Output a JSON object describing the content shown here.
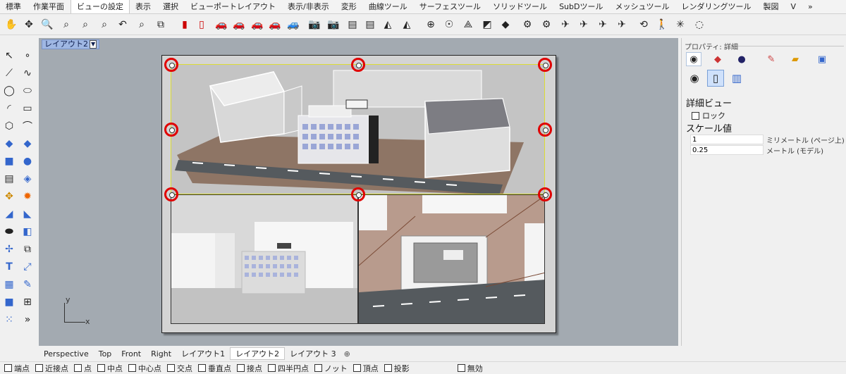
{
  "tabs": [
    "標準",
    "作業平面",
    "ビューの設定",
    "表示",
    "選択",
    "ビューポートレイアウト",
    "表示/非表示",
    "変形",
    "曲線ツール",
    "サーフェスツール",
    "ソリッドツール",
    "SubDツール",
    "メッシュツール",
    "レンダリングツール",
    "製図",
    "V"
  ],
  "active_tab": "ビューの設定",
  "tab_overflow_icon": "chevron-right-icon",
  "viewport": {
    "title": "レイアウト2",
    "axis_x": "x",
    "axis_y": "y"
  },
  "panel": {
    "title": "プロパティ: 詳細",
    "section_detail": "詳細ビュー",
    "lock_label": "ロック",
    "section_scale": "スケール値",
    "page_value": "1",
    "page_unit": "ミリメートル (ページ上)",
    "model_value": "0.25",
    "model_unit": "メートル (モデル)"
  },
  "view_tabs": [
    "Perspective",
    "Top",
    "Front",
    "Right",
    "レイアウト1",
    "レイアウト2",
    "レイアウト 3"
  ],
  "active_view_tab": "レイアウト2",
  "osnap": [
    "端点",
    "近接点",
    "点",
    "中点",
    "中心点",
    "交点",
    "垂直点",
    "接点",
    "四半円点",
    "ノット",
    "頂点",
    "投影",
    "無効"
  ],
  "colors": {
    "handle": "#e00000",
    "detail_border": "#dddd33",
    "viewport_bg": "#a3aab1",
    "title_bg": "#9fb7e3"
  }
}
